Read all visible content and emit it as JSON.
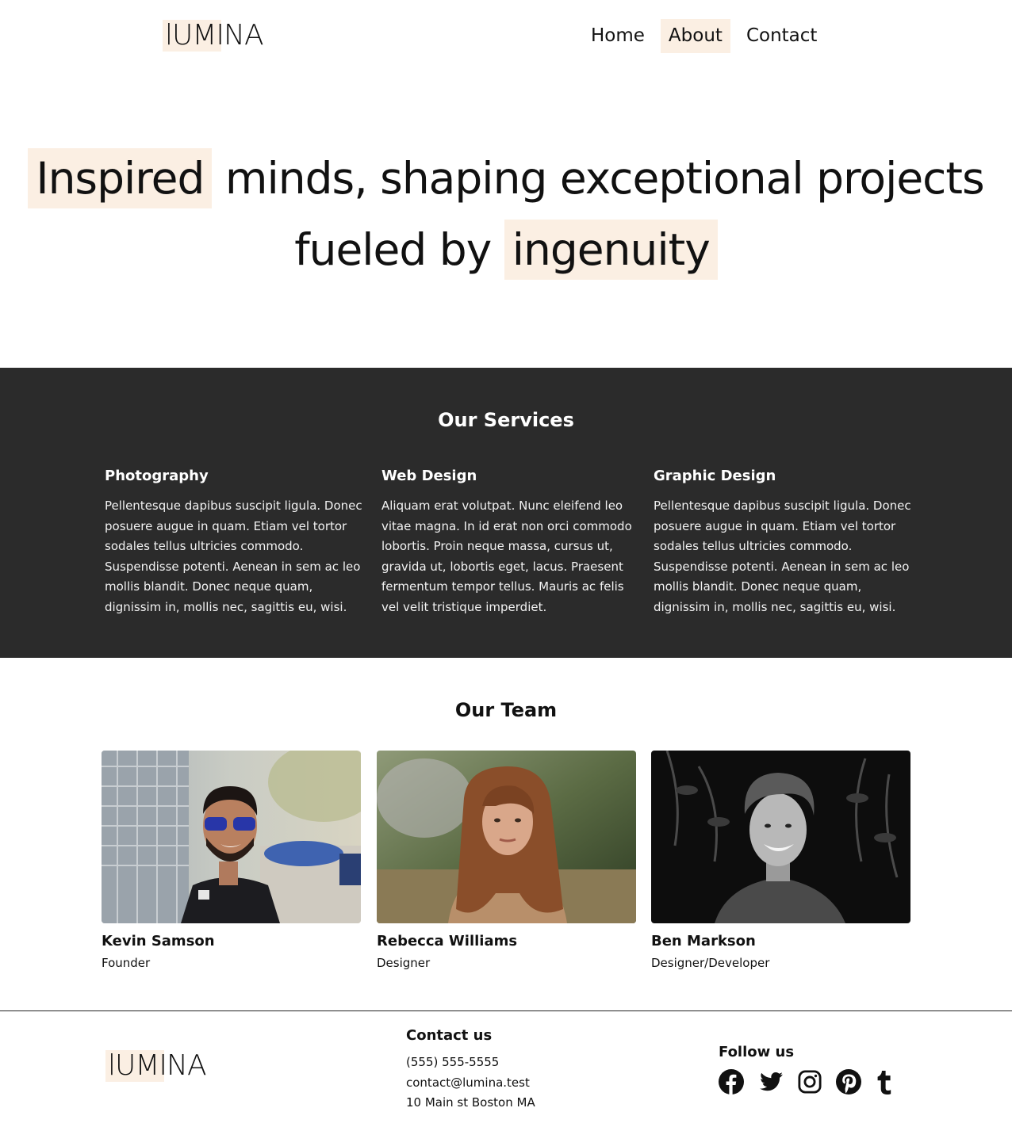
{
  "header": {
    "logo": "lUMINA",
    "nav": [
      {
        "label": "Home",
        "active": false
      },
      {
        "label": "About",
        "active": true
      },
      {
        "label": "Contact",
        "active": false
      }
    ]
  },
  "hero": {
    "line1_highlight": "Inspired",
    "line1_rest": "minds, shaping exceptional projects",
    "line2_lead": "fueled by",
    "line2_highlight": "ingenuity"
  },
  "services": {
    "title": "Our Services",
    "items": [
      {
        "title": "Photography",
        "text": "Pellentesque dapibus suscipit ligula. Donec posuere augue in quam. Etiam vel tortor sodales tellus ultricies commodo. Suspendisse potenti. Aenean in sem ac leo mollis blandit. Donec neque quam, dignissim in, mollis nec, sagittis eu, wisi."
      },
      {
        "title": "Web Design",
        "text": "Aliquam erat volutpat. Nunc eleifend leo vitae magna. In id erat non orci commodo lobortis. Proin neque massa, cursus ut, gravida ut, lobortis eget, lacus. Praesent fermentum tempor tellus. Mauris ac felis vel velit tristique imperdiet."
      },
      {
        "title": "Graphic Design",
        "text": "Pellentesque dapibus suscipit ligula. Donec posuere augue in quam. Etiam vel tortor sodales tellus ultricies commodo. Suspendisse potenti. Aenean in sem ac leo mollis blandit. Donec neque quam, dignissim in, mollis nec, sagittis eu, wisi."
      }
    ]
  },
  "team": {
    "title": "Our Team",
    "members": [
      {
        "name": "Kevin Samson",
        "role": "Founder"
      },
      {
        "name": "Rebecca Williams",
        "role": "Designer"
      },
      {
        "name": "Ben Markson",
        "role": "Designer/Developer"
      }
    ]
  },
  "footer": {
    "logo": "lUMINA",
    "contact_title": "Contact us",
    "phone": "(555) 555-5555",
    "email": "contact@lumina.test",
    "address": "10 Main st Boston MA",
    "follow_title": "Follow us",
    "social_icons": [
      "facebook-icon",
      "twitter-icon",
      "instagram-icon",
      "pinterest-icon",
      "tumblr-icon"
    ]
  },
  "colors": {
    "highlight": "#fbefe3",
    "services_bg": "#2b2b2b",
    "text": "#111111"
  }
}
